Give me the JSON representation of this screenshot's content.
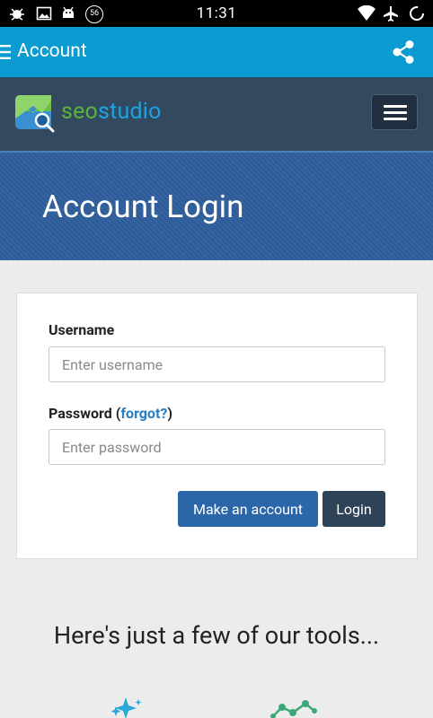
{
  "status_bar": {
    "time": "11:31",
    "badge": "56",
    "left_icons": [
      "bug-icon",
      "image-icon",
      "android-debug-icon",
      "notification-count-icon"
    ],
    "right_icons": [
      "wifi-icon",
      "airplane-icon",
      "sync-icon"
    ]
  },
  "app_bar": {
    "title": "Account",
    "menu_icon": "menu-icon",
    "share_icon": "share-icon"
  },
  "site_header": {
    "logo_seo": "seo",
    "logo_studio": "studio"
  },
  "banner": {
    "heading": "Account Login"
  },
  "login_form": {
    "username_label": "Username",
    "username_placeholder": "Enter username",
    "password_label": "Password",
    "forgot_open": "(",
    "forgot_link": "forgot?",
    "forgot_close": ")",
    "password_placeholder": "Enter password",
    "make_account_label": "Make an account",
    "login_label": "Login"
  },
  "tools": {
    "heading": "Here's just a few of our tools..."
  },
  "colors": {
    "app_bar": "#0a9bd1",
    "site_header": "#32495f",
    "banner": "#2e5e9c",
    "primary_button": "#2b66a8",
    "login_button": "#2f4358",
    "link": "#2a7ec0",
    "logo_green": "#5cb33a",
    "logo_blue": "#1ea3e0"
  }
}
